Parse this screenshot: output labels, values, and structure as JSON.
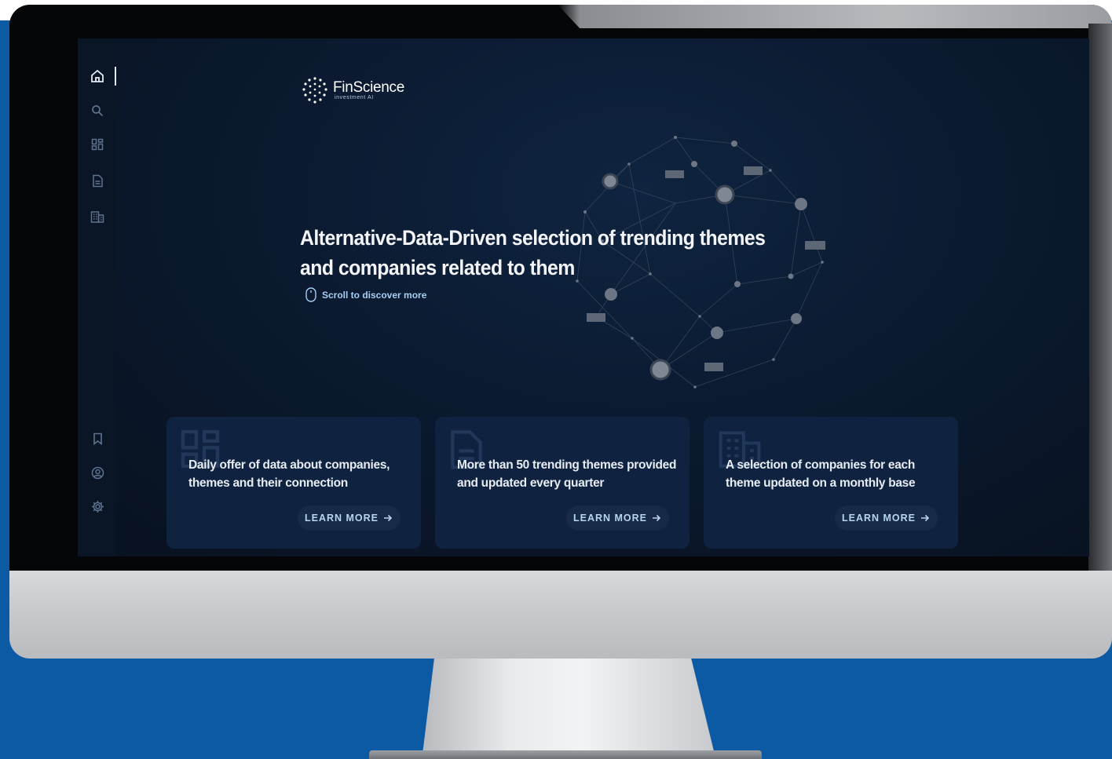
{
  "brand": {
    "name": "FinScience",
    "tagline": "investment AI"
  },
  "hero": {
    "title": "Alternative-Data-Driven selection of trending themes and companies related to them",
    "scroll_hint": "Scroll to discover more"
  },
  "sidebar": {
    "items": [
      {
        "icon": "home-icon",
        "active": true
      },
      {
        "icon": "search-icon"
      },
      {
        "icon": "dashboard-icon"
      },
      {
        "icon": "document-icon"
      },
      {
        "icon": "building-icon"
      },
      {
        "icon": "bookmark-icon"
      },
      {
        "icon": "user-circle-icon"
      },
      {
        "icon": "gear-icon"
      }
    ]
  },
  "cards": [
    {
      "icon": "dashboard-icon",
      "text": "Daily offer of data about companies, themes and their connection",
      "button": "LEARN MORE"
    },
    {
      "icon": "document-icon",
      "text": "More than 50 trending themes provided and updated every quarter",
      "button": "LEARN MORE"
    },
    {
      "icon": "building-icon",
      "text": "A selection of companies for each theme updated on a monthly base",
      "button": "LEARN MORE"
    }
  ],
  "colors": {
    "page_background": "#0d5aa4",
    "screen_background": "#0b1a30",
    "card_background": "#0f2340",
    "accent_text": "#a8cdf2"
  }
}
